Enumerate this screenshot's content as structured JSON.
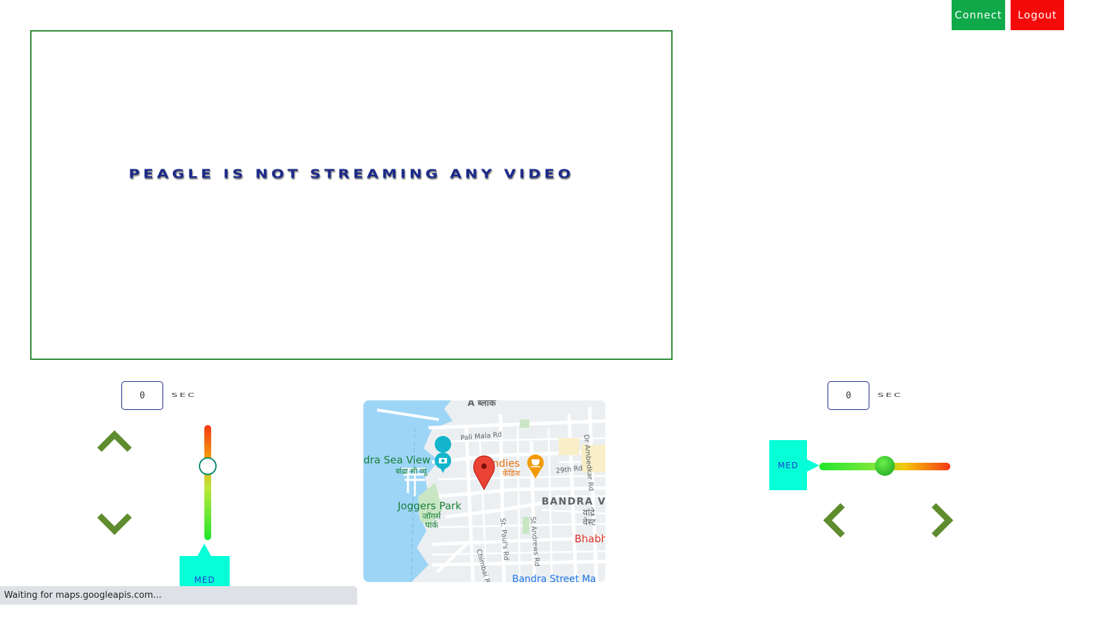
{
  "header": {
    "connect_label": "Connect",
    "logout_label": "Logout",
    "connect_color": "#0fa94a",
    "logout_color": "#f50a0a"
  },
  "video": {
    "message": "Peagle is not streaming any video"
  },
  "left_panel": {
    "timer_value": "0",
    "timer_unit": "sec",
    "up_icon": "chevron-up-icon",
    "down_icon": "chevron-down-icon",
    "speed_label": "MED",
    "speed_level": 0.35
  },
  "right_panel": {
    "timer_value": "0",
    "timer_unit": "sec",
    "left_icon": "chevron-left-icon",
    "right_icon": "chevron-right-icon",
    "speed_label": "MED",
    "speed_level": 0.5
  },
  "map": {
    "labels": {
      "top_partial": "A ब्लॉक",
      "pali_mala": "Pali Mala Rd",
      "sea_view_en": "dra Sea View",
      "sea_view_hi": "बांद्रा सी व्यू",
      "candies_en": "ndies",
      "candies_hi": "कँडिज",
      "rd_29th": "29th Rd",
      "ambedkar": "Dr Ambedkar Rd",
      "bandra_en": "BANDRA V",
      "bandra_hi": "वांद्रे",
      "bandra_hi2": "वेस्ट",
      "joggers_en": "Joggers Park",
      "joggers_hi": "जॉगर्स",
      "joggers_hi2": "पार्क",
      "st_pauls": "St. Paul's Rd",
      "st_andrews": "St Andrews Rd",
      "chimbai": "Chimbai R",
      "bhabha": "Bhabh",
      "bandra_street": "Bandra Street Ma"
    },
    "pin_icon": "map-pin-icon",
    "camera_icon": "camera-icon",
    "cafe_icon": "cafe-icon"
  },
  "status_bar": {
    "text": "Waiting for maps.googleapis.com..."
  }
}
